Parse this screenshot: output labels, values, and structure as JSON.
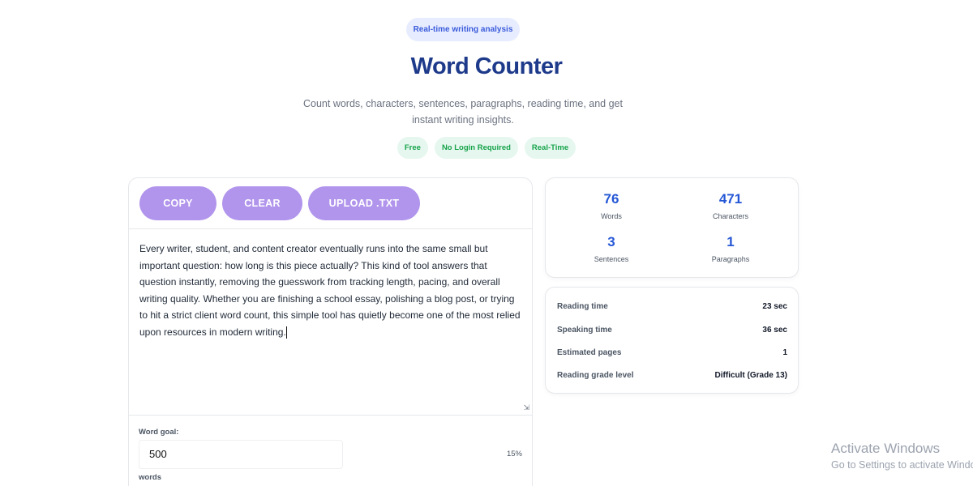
{
  "hero": {
    "pill": "Real-time writing analysis",
    "title": "Word Counter",
    "subtitle": "Count words, characters, sentences, paragraphs, reading time, and get instant writing insights.",
    "tags": [
      "Free",
      "No Login Required",
      "Real-Time"
    ]
  },
  "toolbar": {
    "copy_label": "COPY",
    "clear_label": "CLEAR",
    "upload_label": "UPLOAD .TXT"
  },
  "editor": {
    "text": "Every writer, student, and content creator eventually runs into the same small but important question: how long is this piece actually? This kind of tool answers that question instantly, removing the guesswork from tracking length, pacing, and overall writing quality. Whether you are finishing a school essay, polishing a blog post, or trying to hit a strict client word count, this simple tool has quietly become one of the most relied upon resources in modern writing."
  },
  "goal": {
    "label": "Word goal:",
    "value": "500",
    "percent": "15%",
    "unit": "words"
  },
  "stats": {
    "words": {
      "value": "76",
      "label": "Words"
    },
    "characters": {
      "value": "471",
      "label": "Characters"
    },
    "sentences": {
      "value": "3",
      "label": "Sentences"
    },
    "paragraphs": {
      "value": "1",
      "label": "Paragraphs"
    }
  },
  "metrics": {
    "reading_time": {
      "label": "Reading time",
      "value": "23 sec"
    },
    "speaking_time": {
      "label": "Speaking time",
      "value": "36 sec"
    },
    "pages": {
      "label": "Estimated pages",
      "value": "1"
    },
    "grade": {
      "label": "Reading grade level",
      "value": "Difficult (Grade 13)"
    }
  },
  "watermark": {
    "title": "Activate Windows",
    "subtitle": "Go to Settings to activate Windows."
  },
  "colors": {
    "accent": "#b194ec",
    "title": "#1e3a8a",
    "stat_value": "#2557d6",
    "tag_text": "#16a34a"
  }
}
